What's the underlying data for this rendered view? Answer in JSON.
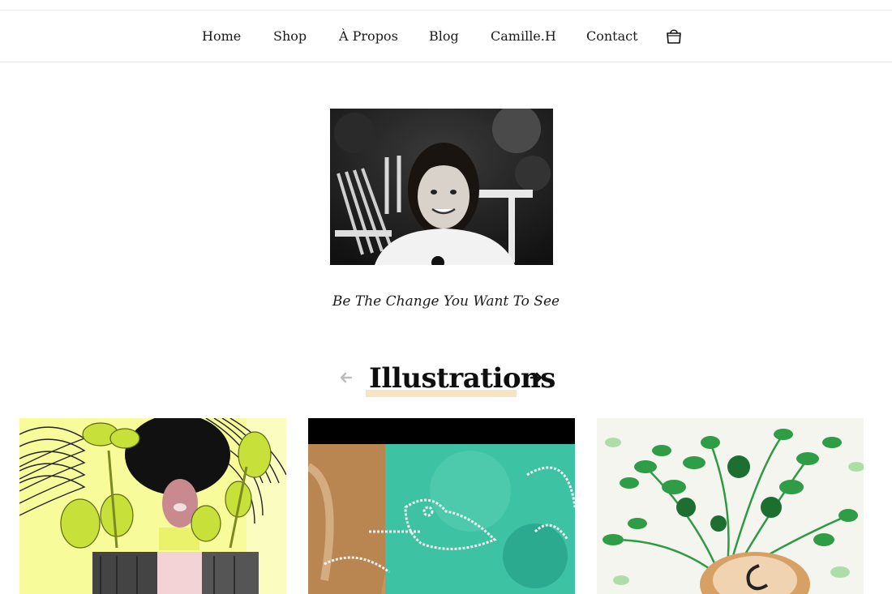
{
  "nav": {
    "items": [
      {
        "label": "Home"
      },
      {
        "label": "Shop"
      },
      {
        "label": "À Propos"
      },
      {
        "label": "Blog"
      },
      {
        "label": "Camille.H"
      },
      {
        "label": "Contact"
      }
    ],
    "cart_icon": "shopping-bag-icon"
  },
  "hero": {
    "image": "child-portrait-photo",
    "tagline": "Be The Change You Want To See"
  },
  "section": {
    "title": "Illustrations",
    "prev_icon": "arrow-left-icon",
    "next_icon": "arrow-right-icon",
    "accent_color": "#f6e4c4"
  },
  "gallery": [
    {
      "image": "illustration-plants-afro-figure"
    },
    {
      "image": "illustration-teal-bird-watercolor"
    },
    {
      "image": "illustration-green-fern-pot"
    }
  ]
}
